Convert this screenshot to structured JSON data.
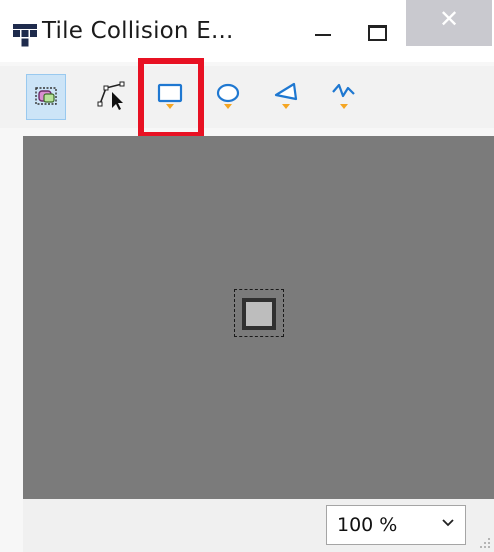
{
  "window": {
    "title": "Tile Collision E...",
    "close_glyph": "✕",
    "icons": {
      "app": "tiled-logo-icon",
      "minimize": "minimize-icon",
      "maximize": "maximize-icon",
      "close": "close-icon"
    }
  },
  "toolbar": {
    "tools": [
      {
        "name": "select-objects-tool",
        "icon": "select-objects-icon",
        "selected": true
      },
      {
        "name": "edit-polygons-tool",
        "icon": "edit-polygons-icon",
        "selected": false
      },
      {
        "name": "insert-rectangle-tool",
        "icon": "insert-rectangle-icon",
        "selected": false,
        "highlighted": true
      },
      {
        "name": "insert-ellipse-tool",
        "icon": "insert-ellipse-icon",
        "selected": false
      },
      {
        "name": "insert-polygon-tool",
        "icon": "insert-polygon-icon",
        "selected": false
      },
      {
        "name": "insert-polyline-tool",
        "icon": "insert-polyline-icon",
        "selected": false
      }
    ],
    "highlight_color": "#e81123"
  },
  "canvas": {
    "background": "#7b7b7b"
  },
  "statusbar": {
    "zoom": "100 %"
  }
}
